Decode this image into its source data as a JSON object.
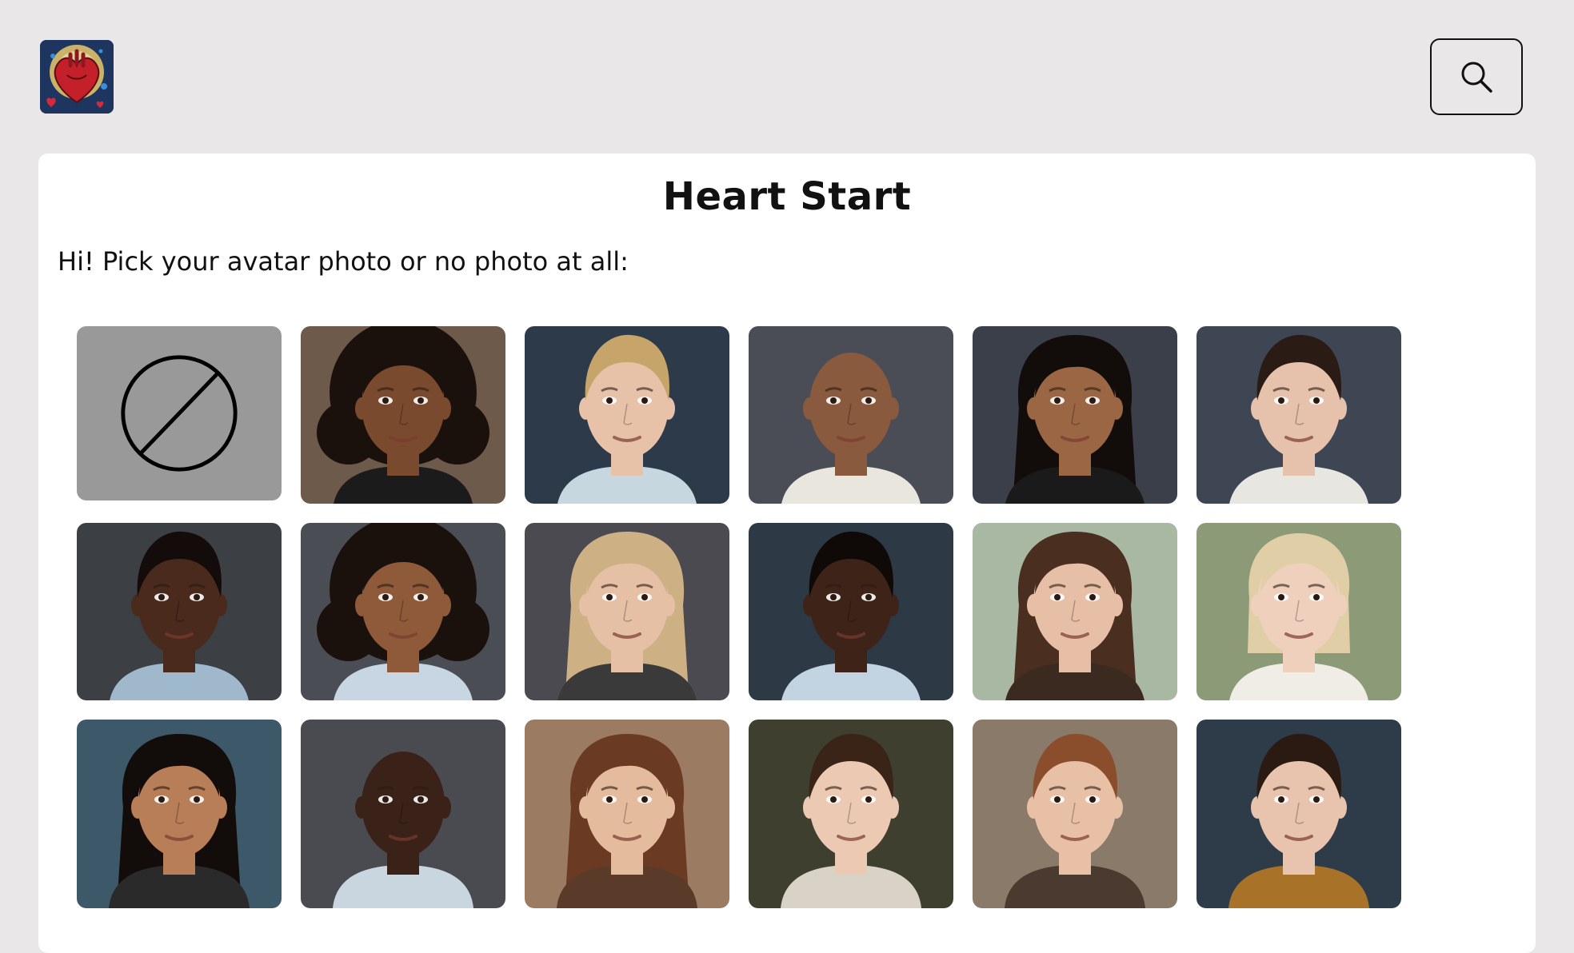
{
  "header": {
    "logo_icon": "anatomical-heart-logo-icon",
    "search_icon": "search-icon"
  },
  "main": {
    "title": "Heart Start",
    "prompt": "Hi! Pick your avatar photo or no photo at all:"
  },
  "avatar_options": [
    {
      "kind": "none",
      "icon": "no-photo-icon",
      "bg": "#999999"
    },
    {
      "kind": "photo",
      "bg": "#6e5a4b",
      "skin": "#7a4a2e",
      "hair": "#1a100c",
      "hair_style": "curly",
      "shirt": "#1b1b1b"
    },
    {
      "kind": "photo",
      "bg": "#2c3a4a",
      "skin": "#e8c2a8",
      "hair": "#c7a46a",
      "hair_style": "short",
      "shirt": "#c7d7e0"
    },
    {
      "kind": "photo",
      "bg": "#4a4d55",
      "skin": "#8a5a3e",
      "hair": "#8a5a3e",
      "hair_style": "bald",
      "shirt": "#e9e6de"
    },
    {
      "kind": "photo",
      "bg": "#3a3f49",
      "skin": "#9a6644",
      "hair": "#120c0a",
      "hair_style": "long",
      "shirt": "#1a1a1a"
    },
    {
      "kind": "photo",
      "bg": "#3e4653",
      "skin": "#e6c1ab",
      "hair": "#2a1b14",
      "hair_style": "short",
      "shirt": "#e8e6e0"
    },
    {
      "kind": "photo",
      "bg": "#3c4044",
      "skin": "#4a2a1c",
      "hair": "#140c0a",
      "hair_style": "short",
      "shirt": "#9fb8cc"
    },
    {
      "kind": "photo",
      "bg": "#4b4d55",
      "skin": "#8e5a3a",
      "hair": "#1a110c",
      "hair_style": "curly",
      "shirt": "#c8d6e4"
    },
    {
      "kind": "photo",
      "bg": "#4a4a50",
      "skin": "#e5c0a4",
      "hair": "#cdb184",
      "hair_style": "long",
      "shirt": "#3a3a3a"
    },
    {
      "kind": "photo",
      "bg": "#2e3946",
      "skin": "#3e2418",
      "hair": "#0f0a08",
      "hair_style": "short",
      "shirt": "#c2d4e2"
    },
    {
      "kind": "photo",
      "bg": "#a9b8a2",
      "skin": "#e6bfa6",
      "hair": "#4a2e20",
      "hair_style": "long",
      "shirt": "#3a2a20"
    },
    {
      "kind": "photo",
      "bg": "#8c9a78",
      "skin": "#efd0bc",
      "hair": "#e0cfa6",
      "hair_style": "bob",
      "shirt": "#f0ece6"
    },
    {
      "kind": "photo",
      "bg": "#3d5868",
      "skin": "#b77e58",
      "hair": "#120c0a",
      "hair_style": "long",
      "shirt": "#2a2a2a"
    },
    {
      "kind": "photo",
      "bg": "#4a4b50",
      "skin": "#3a2218",
      "hair": "#3a2218",
      "hair_style": "bald",
      "shirt": "#c9d5df"
    },
    {
      "kind": "photo",
      "bg": "#9b7c63",
      "skin": "#e4bb9c",
      "hair": "#6a3a22",
      "hair_style": "long",
      "shirt": "#5a3a28"
    },
    {
      "kind": "photo",
      "bg": "#3f3f30",
      "skin": "#ecc9b2",
      "hair": "#3a2418",
      "hair_style": "short",
      "shirt": "#d9d2c6"
    },
    {
      "kind": "photo",
      "bg": "#8a7a6a",
      "skin": "#e8c0a6",
      "hair": "#8a4e2c",
      "hair_style": "short",
      "shirt": "#4a3a30"
    },
    {
      "kind": "photo",
      "bg": "#2e3b48",
      "skin": "#e8c4ae",
      "hair": "#2a1a12",
      "hair_style": "short",
      "shirt": "#a87328"
    }
  ]
}
